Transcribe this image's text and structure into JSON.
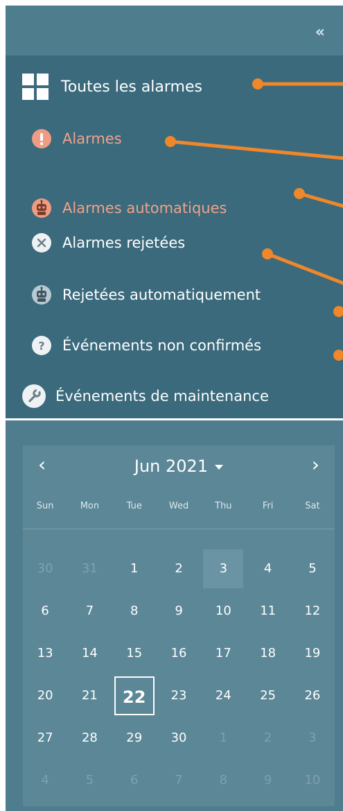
{
  "sidebar": {
    "collapse_glyph": "«",
    "all_alarms": "Toutes les alarmes",
    "items": [
      {
        "label": "Alarmes",
        "icon": "exclamation-icon",
        "color": "#f2a28a"
      },
      {
        "label": "Alarmes automatiques",
        "icon": "robot-icon",
        "color": "#f2a28a"
      },
      {
        "label": "Alarmes rejetées",
        "icon": "reject-x-icon",
        "color": "#ffffff"
      },
      {
        "label": "Rejetées automatiquement",
        "icon": "robot-icon",
        "color": "#ffffff"
      },
      {
        "label": "Événements non confirmés",
        "icon": "question-icon",
        "color": "#ffffff"
      },
      {
        "label": "Événements de maintenance",
        "icon": "wrench-icon",
        "color": "#ffffff"
      }
    ]
  },
  "calendar": {
    "month_label": "Jun 2021",
    "weekdays": [
      "Sun",
      "Mon",
      "Tue",
      "Wed",
      "Thu",
      "Fri",
      "Sat"
    ],
    "weeks": [
      [
        "30",
        "31",
        "1",
        "2",
        "3",
        "4",
        "5"
      ],
      [
        "6",
        "7",
        "8",
        "9",
        "10",
        "11",
        "12"
      ],
      [
        "13",
        "14",
        "15",
        "16",
        "17",
        "18",
        "19"
      ],
      [
        "20",
        "21",
        "22",
        "23",
        "24",
        "25",
        "26"
      ],
      [
        "27",
        "28",
        "29",
        "30",
        "1",
        "2",
        "3"
      ],
      [
        "4",
        "5",
        "6",
        "7",
        "8",
        "9",
        "10"
      ]
    ],
    "selected_day": "22",
    "highlighted_day": "3"
  },
  "colors": {
    "accent_orange": "#f0872a",
    "nav_bg": "#3a6a7c",
    "calendar_bg": "#5b8797"
  }
}
